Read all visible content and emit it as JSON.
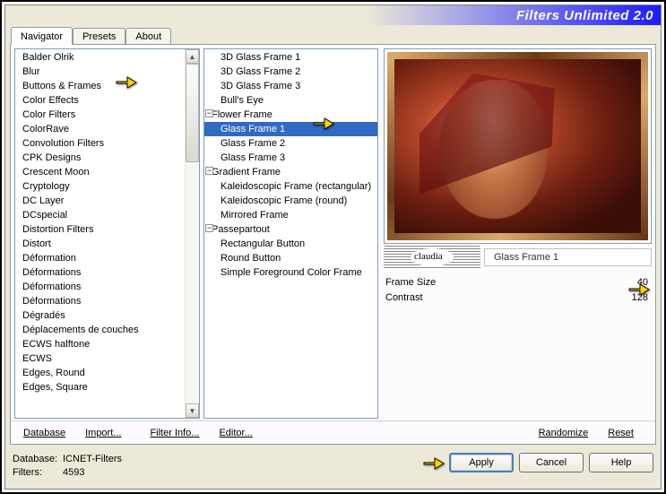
{
  "title": "Filters Unlimited 2.0",
  "tabs": [
    "Navigator",
    "Presets",
    "About"
  ],
  "activeTab": 0,
  "categories": [
    "Balder Olrik",
    "Blur",
    "Buttons & Frames",
    "Color Effects",
    "Color Filters",
    "ColorRave",
    "Convolution Filters",
    "CPK Designs",
    "Crescent Moon",
    "Cryptology",
    "DC Layer",
    "DCspecial",
    "Distortion Filters",
    "Distort",
    "Déformation",
    "Déformations",
    "Déformations",
    "Déformations",
    "Dégradés",
    "Déplacements de couches",
    "ECWS halftone",
    "ECWS",
    "Edges, Round",
    "Edges, Square"
  ],
  "selectedCategoryIndex": 2,
  "filters": [
    {
      "label": "3D Glass Frame 1",
      "child": true
    },
    {
      "label": "3D Glass Frame 2",
      "child": true
    },
    {
      "label": "3D Glass Frame 3",
      "child": true
    },
    {
      "label": "Bull's Eye",
      "child": true
    },
    {
      "label": "Flower Frame",
      "child": false,
      "expander": "-"
    },
    {
      "label": "Glass Frame 1",
      "child": true,
      "selected": true
    },
    {
      "label": "Glass Frame 2",
      "child": true
    },
    {
      "label": "Glass Frame 3",
      "child": true
    },
    {
      "label": "Gradient Frame",
      "child": false,
      "expander": "-"
    },
    {
      "label": "Kaleidoscopic Frame (rectangular)",
      "child": true
    },
    {
      "label": "Kaleidoscopic Frame (round)",
      "child": true
    },
    {
      "label": "Mirrored Frame",
      "child": true
    },
    {
      "label": "Passepartout",
      "child": false,
      "expander": "-"
    },
    {
      "label": "Rectangular Button",
      "child": true
    },
    {
      "label": "Round Button",
      "child": true
    },
    {
      "label": "Simple Foreground Color Frame",
      "child": true
    }
  ],
  "currentFilterLabel": "Glass Frame 1",
  "logoText": "claudia",
  "params": [
    {
      "name": "Frame Size",
      "value": "40"
    },
    {
      "name": "Contrast",
      "value": "128"
    }
  ],
  "links": {
    "db": "Database",
    "imp": "Import...",
    "fi": "Filter Info...",
    "ed": "Editor...",
    "rand": "Randomize",
    "reset": "Reset"
  },
  "meta": {
    "dbLabel": "Database:",
    "dbVal": "ICNET-Filters",
    "flLabel": "Filters:",
    "flVal": "4593"
  },
  "buttons": {
    "apply": "Apply",
    "cancel": "Cancel",
    "help": "Help"
  }
}
